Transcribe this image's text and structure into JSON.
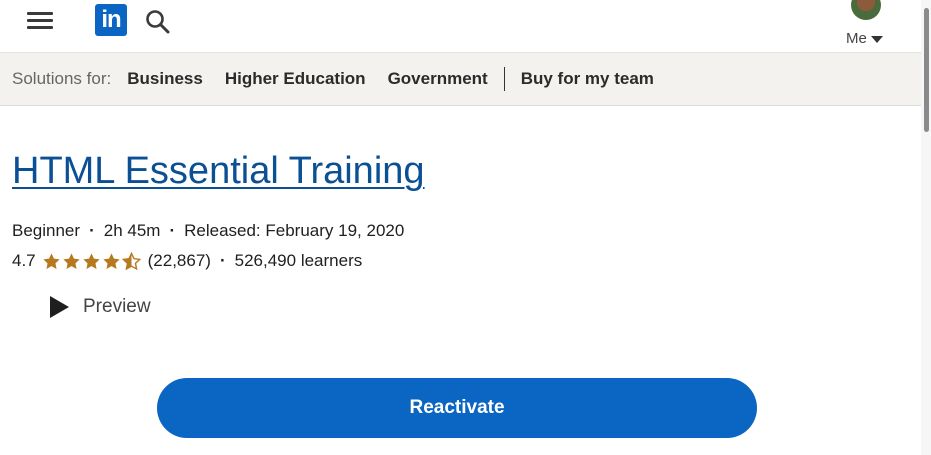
{
  "nav": {
    "logo_text": "in",
    "me_label": "Me"
  },
  "solutions": {
    "label": "Solutions for:",
    "links": [
      "Business",
      "Higher Education",
      "Government",
      "Buy for my team"
    ]
  },
  "course": {
    "title": "HTML Essential Training",
    "level": "Beginner",
    "duration": "2h 45m",
    "released": "Released: February 19, 2020",
    "rating": "4.7",
    "stars_value": 4.5,
    "rating_count": "(22,867)",
    "learners": "526,490 learners",
    "preview_label": "Preview"
  },
  "cta": {
    "label": "Reactivate",
    "color": "#0a66c2"
  }
}
